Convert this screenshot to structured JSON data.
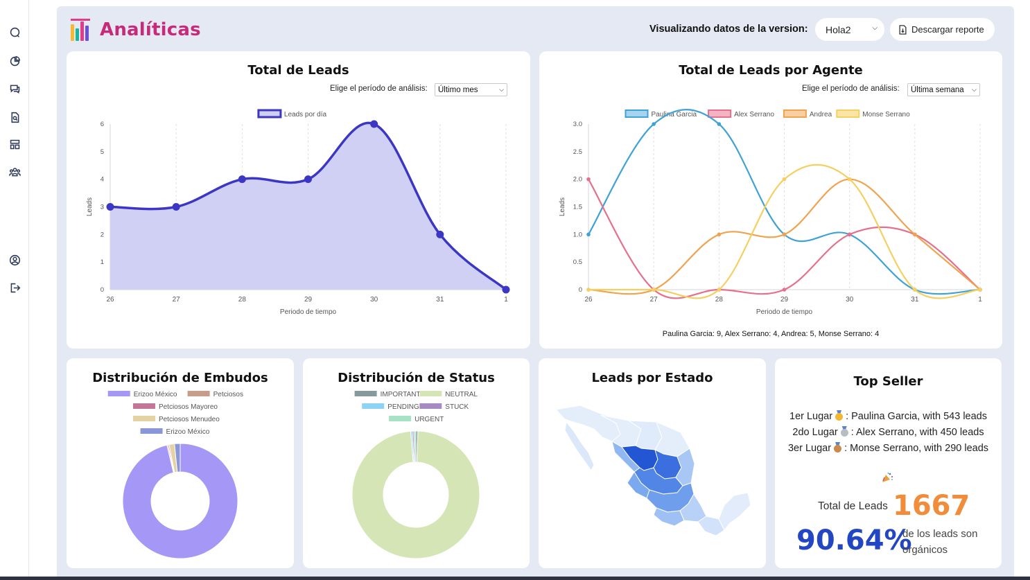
{
  "header": {
    "title": "Analíticas",
    "version_label": "Visualizando datos de la version:",
    "version_value": "Hola2",
    "download_label": "Descargar reporte"
  },
  "sidebar": {
    "icons": [
      "search-icon",
      "pie-chart-icon",
      "chat-icon",
      "document-search-icon",
      "layout-icon",
      "team-icon",
      "user-circle-icon",
      "logout-icon"
    ]
  },
  "total_leads": {
    "title": "Total de Leads",
    "period_label": "Elige el período de análisis:",
    "period_value": "Último mes"
  },
  "leads_by_agent": {
    "title": "Total de Leads por Agente",
    "period_label": "Elige el período de análisis:",
    "period_value": "Última semana",
    "summary": "Paulina Garcia: 9, Alex Serrano: 4, Andrea: 5, Monse Serrano: 4"
  },
  "funnels": {
    "title": "Distribución de Embudos"
  },
  "status": {
    "title": "Distribución de Status"
  },
  "states": {
    "title": "Leads por Estado"
  },
  "top_seller": {
    "title": "Top Seller",
    "lines": [
      {
        "place": "1er Lugar",
        "text": ": Paulina Garcia, with 543 leads",
        "medal": "#f2b632"
      },
      {
        "place": "2do Lugar",
        "text": ": Alex Serrano, with 450 leads",
        "medal": "#b8bcc4"
      },
      {
        "place": "3er Lugar",
        "text": ": Monse Serrano, with 290 leads",
        "medal": "#c98a4b"
      }
    ],
    "total_label": "Total de Leads",
    "total_value": "1667",
    "organic_pct": "90.64%",
    "organic_text": "de los leads son orgánicos"
  },
  "chart_data": [
    {
      "type": "area",
      "categories": [
        "26",
        "27",
        "28",
        "29",
        "30",
        "31",
        "1"
      ],
      "series": [
        {
          "name": "Leads por día",
          "values": [
            3,
            3,
            4,
            4,
            6,
            2,
            0
          ],
          "color": "#3b36c4",
          "fill": "#d0cff4"
        }
      ],
      "xlabel": "Periodo de tiempo",
      "ylabel": "Leads",
      "ylim": [
        0,
        6
      ],
      "yticks": [
        "0",
        "1",
        "2",
        "3",
        "4",
        "5",
        "6"
      ],
      "legend": "top"
    },
    {
      "type": "line",
      "categories": [
        "26",
        "27",
        "28",
        "29",
        "30",
        "31",
        "1"
      ],
      "series": [
        {
          "name": "Paulina Garcia",
          "values": [
            1,
            3,
            3,
            1,
            1,
            0,
            0
          ],
          "color": "#3ea2d6",
          "fill": "#a6d4f0"
        },
        {
          "name": "Alex Serrano",
          "values": [
            2,
            0,
            0,
            0,
            1,
            1,
            0
          ],
          "color": "#e6708c",
          "fill": "#f3b3c2"
        },
        {
          "name": "Andrea",
          "values": [
            0,
            0,
            1,
            1,
            2,
            1,
            0
          ],
          "color": "#f0a24e",
          "fill": "#f8cfa2"
        },
        {
          "name": "Monse Serrano",
          "values": [
            0,
            0,
            0,
            2,
            2,
            0,
            0
          ],
          "color": "#f5cf60",
          "fill": "#fbe5a6"
        }
      ],
      "xlabel": "Periodo de tiempo",
      "ylabel": "Leads",
      "ylim": [
        0,
        3
      ],
      "yticks": [
        "0",
        "0.5",
        "1.0",
        "1.5",
        "2.0",
        "2.5",
        "3.0"
      ],
      "legend": "top"
    },
    {
      "type": "pie",
      "variant": "doughnut",
      "labels": [
        "Erizoo México",
        "Petciosos",
        "Petciosos Mayoreo",
        "Petciosos Menudeo",
        "Erizoo México"
      ],
      "values": [
        96.3,
        0.3,
        0.3,
        1.5,
        1.6
      ],
      "colors": [
        "#a497f6",
        "#c79c8a",
        "#c4769a",
        "#e4d1a4",
        "#8b96d9"
      ],
      "legend": "top"
    },
    {
      "type": "pie",
      "variant": "doughnut",
      "labels": [
        "IMPORTANT",
        "NEUTRAL",
        "PENDING",
        "STUCK",
        "URGENT"
      ],
      "values": [
        0.5,
        98.2,
        0.4,
        0.4,
        0.5
      ],
      "colors": [
        "#87999a",
        "#d6e5b5",
        "#8dd3f5",
        "#a68bc3",
        "#a6e3c5"
      ],
      "legend": "top"
    }
  ]
}
